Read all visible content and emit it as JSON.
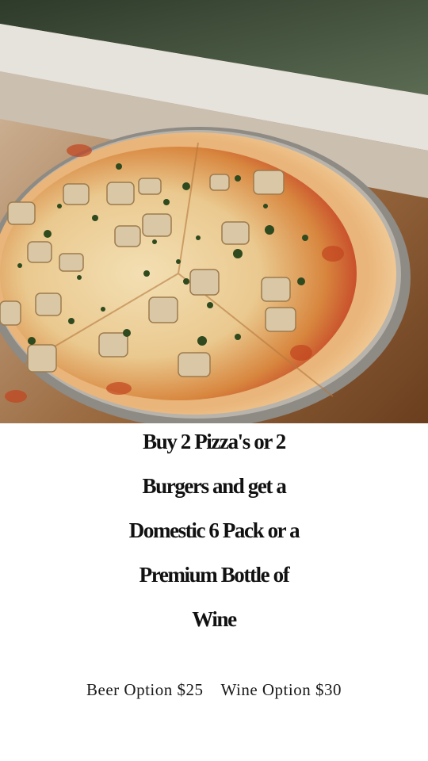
{
  "promo": {
    "headline_lines": [
      "Buy 2 Pizza's or 2",
      "Burgers and get a",
      "Domestic 6 Pack or a",
      "Premium Bottle of",
      "Wine"
    ],
    "beer_option": "Beer Option $25",
    "wine_option": "Wine Option $30"
  },
  "colors": {
    "text": "#111111",
    "background": "#ffffff"
  }
}
